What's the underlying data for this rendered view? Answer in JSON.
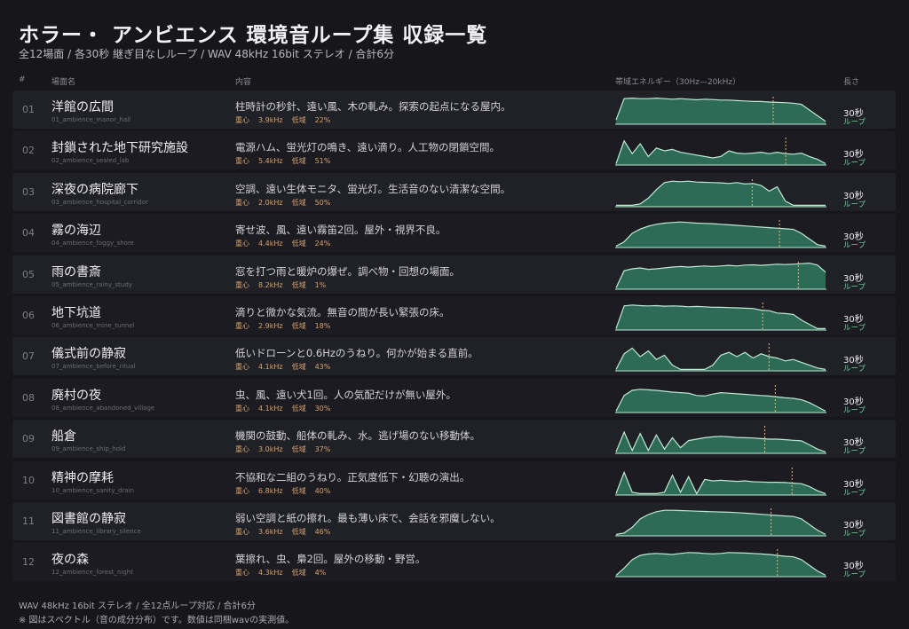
{
  "header": {
    "title": "ホラー・ アンビエンス 環境音ループ集 収録一覧",
    "subtitle": "全12場面 / 各30秒 継ぎ目なしループ / WAV 48kHz 16bit ステレオ / 合計6分"
  },
  "columns": {
    "num": "#",
    "name": "場面名",
    "desc": "内容",
    "spectrum": "帯域エネルギー（30Hz—20kHz）",
    "length": "長さ"
  },
  "labels": {
    "centroid": "重心",
    "low": "低域",
    "loop": "ループ"
  },
  "colors": {
    "fill": "#2e6b57",
    "stroke": "#bde9d2",
    "marker": "#e8b478"
  },
  "rows": [
    {
      "num": "01",
      "name": "洋館の広間",
      "file": "01_ambience_manor_hall",
      "desc": "柱時計の秒針、遠い風、木の軋み。探索の起点になる屋内。",
      "centroid": "3.9kHz",
      "low": "22%",
      "duration": "30秒",
      "spectrum": [
        0.15,
        0.9,
        0.92,
        0.9,
        0.9,
        0.92,
        0.9,
        0.88,
        0.9,
        0.88,
        0.86,
        0.88,
        0.87,
        0.85,
        0.85,
        0.83,
        0.82,
        0.8,
        0.8,
        0.78,
        0.77,
        0.76,
        0.74,
        0.7,
        0.5,
        0.3,
        0.1
      ],
      "marker": 0.75
    },
    {
      "num": "02",
      "name": "封鎖された地下研究施設",
      "file": "02_ambience_sealed_lab",
      "desc": "電源ハム、蛍光灯の鳴き、遠い滴り。人工物の閉鎖空間。",
      "centroid": "5.4kHz",
      "low": "51%",
      "duration": "30秒",
      "spectrum": [
        0.05,
        0.85,
        0.4,
        0.75,
        0.3,
        0.6,
        0.5,
        0.55,
        0.45,
        0.4,
        0.35,
        0.3,
        0.25,
        0.3,
        0.5,
        0.42,
        0.4,
        0.42,
        0.45,
        0.4,
        0.45,
        0.4,
        0.38,
        0.42,
        0.3,
        0.2,
        0.05
      ],
      "marker": 0.81
    },
    {
      "num": "03",
      "name": "深夜の病院廊下",
      "file": "03_ambience_hospital_corridor",
      "desc": "空調、遠い生体モニタ、蛍光灯。生活音のない清潔な空間。",
      "centroid": "2.0kHz",
      "low": "50%",
      "duration": "30秒",
      "spectrum": [
        0.05,
        0.05,
        0.05,
        0.1,
        0.3,
        0.6,
        0.85,
        0.9,
        0.88,
        0.9,
        0.87,
        0.86,
        0.85,
        0.84,
        0.82,
        0.85,
        0.8,
        0.82,
        0.75,
        0.55,
        0.7,
        0.2,
        0.05,
        0.05,
        0.05,
        0.05,
        0.05
      ],
      "marker": 0.65
    },
    {
      "num": "04",
      "name": "霧の海辺",
      "file": "04_ambience_foggy_shore",
      "desc": "寄せ波、風、遠い霧笛2回。屋外・視界不良。",
      "centroid": "4.4kHz",
      "low": "24%",
      "duration": "30秒",
      "spectrum": [
        0.05,
        0.2,
        0.5,
        0.65,
        0.75,
        0.82,
        0.86,
        0.88,
        0.9,
        0.88,
        0.86,
        0.85,
        0.84,
        0.82,
        0.8,
        0.78,
        0.76,
        0.74,
        0.72,
        0.7,
        0.68,
        0.66,
        0.64,
        0.5,
        0.3,
        0.1,
        0.05
      ],
      "marker": 0.78
    },
    {
      "num": "05",
      "name": "雨の書斎",
      "file": "05_ambience_rainy_study",
      "desc": "窓を打つ雨と暖炉の爆ぜ。調べ物・回想の場面。",
      "centroid": "8.2kHz",
      "low": "1%",
      "duration": "30秒",
      "spectrum": [
        0.05,
        0.65,
        0.72,
        0.75,
        0.7,
        0.72,
        0.75,
        0.78,
        0.8,
        0.78,
        0.8,
        0.82,
        0.8,
        0.82,
        0.84,
        0.82,
        0.85,
        0.86,
        0.84,
        0.86,
        0.88,
        0.87,
        0.88,
        0.9,
        0.92,
        0.85,
        0.6
      ],
      "marker": 0.87
    },
    {
      "num": "06",
      "name": "地下坑道",
      "file": "06_ambience_mine_tunnel",
      "desc": "滴りと微かな気流。無音の間が長い緊張の床。",
      "centroid": "2.9kHz",
      "low": "18%",
      "duration": "30秒",
      "spectrum": [
        0.05,
        0.85,
        0.88,
        0.86,
        0.85,
        0.86,
        0.84,
        0.85,
        0.84,
        0.82,
        0.83,
        0.82,
        0.8,
        0.8,
        0.79,
        0.78,
        0.77,
        0.76,
        0.7,
        0.68,
        0.6,
        0.58,
        0.55,
        0.35,
        0.2,
        0.05,
        0.05
      ],
      "marker": 0.7
    },
    {
      "num": "07",
      "name": "儀式前の静寂",
      "file": "07_ambience_before_ritual",
      "desc": "低いドローンと0.6Hzのうねり。何かが始まる直前。",
      "centroid": "4.1kHz",
      "low": "43%",
      "duration": "30秒",
      "spectrum": [
        0.05,
        0.6,
        0.8,
        0.5,
        0.7,
        0.4,
        0.55,
        0.2,
        0.05,
        0.05,
        0.05,
        0.05,
        0.2,
        0.55,
        0.65,
        0.5,
        0.65,
        0.45,
        0.6,
        0.5,
        0.45,
        0.35,
        0.4,
        0.3,
        0.2,
        0.1,
        0.05
      ],
      "marker": 0.73
    },
    {
      "num": "08",
      "name": "廃村の夜",
      "file": "08_ambience_abandoned_village",
      "desc": "虫、風、遠い犬1回。人の気配だけが無い屋外。",
      "centroid": "4.1kHz",
      "low": "30%",
      "duration": "30秒",
      "spectrum": [
        0.05,
        0.6,
        0.78,
        0.82,
        0.8,
        0.78,
        0.75,
        0.72,
        0.7,
        0.68,
        0.6,
        0.58,
        0.65,
        0.7,
        0.68,
        0.66,
        0.64,
        0.62,
        0.6,
        0.58,
        0.55,
        0.52,
        0.5,
        0.45,
        0.35,
        0.2,
        0.05
      ],
      "marker": 0.76
    },
    {
      "num": "09",
      "name": "船倉",
      "file": "09_ambience_ship_hold",
      "desc": "機関の鼓動、船体の軋み、水。逃げ場のない移動体。",
      "centroid": "3.0kHz",
      "low": "37%",
      "duration": "30秒",
      "spectrum": [
        0.05,
        0.75,
        0.1,
        0.7,
        0.1,
        0.65,
        0.15,
        0.55,
        0.2,
        0.45,
        0.5,
        0.55,
        0.58,
        0.6,
        0.58,
        0.56,
        0.55,
        0.54,
        0.52,
        0.5,
        0.5,
        0.48,
        0.46,
        0.44,
        0.3,
        0.15,
        0.05
      ],
      "marker": 0.71
    },
    {
      "num": "10",
      "name": "精神の摩耗",
      "file": "10_ambience_sanity_drain",
      "desc": "不協和な二組のうねり。正気度低下・幻聴の演出。",
      "centroid": "6.8kHz",
      "low": "40%",
      "duration": "30秒",
      "spectrum": [
        0.05,
        0.8,
        0.1,
        0.05,
        0.05,
        0.05,
        0.1,
        0.7,
        0.1,
        0.65,
        0.05,
        0.55,
        0.5,
        0.52,
        0.5,
        0.48,
        0.5,
        0.47,
        0.46,
        0.45,
        0.45,
        0.44,
        0.42,
        0.4,
        0.3,
        0.15,
        0.05
      ],
      "marker": 0.84
    },
    {
      "num": "11",
      "name": "図書館の静寂",
      "file": "11_ambience_library_silence",
      "desc": "弱い空調と紙の擦れ。最も薄い床で、会話を邪魔しない。",
      "centroid": "3.6kHz",
      "low": "46%",
      "duration": "30秒",
      "spectrum": [
        0.05,
        0.1,
        0.3,
        0.6,
        0.75,
        0.85,
        0.9,
        0.9,
        0.89,
        0.88,
        0.87,
        0.86,
        0.85,
        0.84,
        0.83,
        0.82,
        0.8,
        0.78,
        0.76,
        0.74,
        0.72,
        0.7,
        0.68,
        0.6,
        0.4,
        0.2,
        0.05
      ],
      "marker": 0.74
    },
    {
      "num": "12",
      "name": "夜の森",
      "file": "12_ambience_forest_night",
      "desc": "葉擦れ、虫、梟2回。屋外の移動・野営。",
      "centroid": "4.3kHz",
      "low": "4%",
      "duration": "30秒",
      "spectrum": [
        0.05,
        0.3,
        0.6,
        0.75,
        0.8,
        0.82,
        0.8,
        0.78,
        0.82,
        0.85,
        0.84,
        0.82,
        0.8,
        0.82,
        0.85,
        0.84,
        0.83,
        0.82,
        0.8,
        0.78,
        0.75,
        0.72,
        0.7,
        0.6,
        0.4,
        0.2,
        0.05
      ],
      "marker": 0.77
    }
  ],
  "footer": {
    "line1": "WAV 48kHz 16bit ステレオ / 全12点ループ対応 / 合計6分",
    "line2": "※ 図はスペクトル（音の成分分布）です。数値は同梱wavの実測値。"
  }
}
